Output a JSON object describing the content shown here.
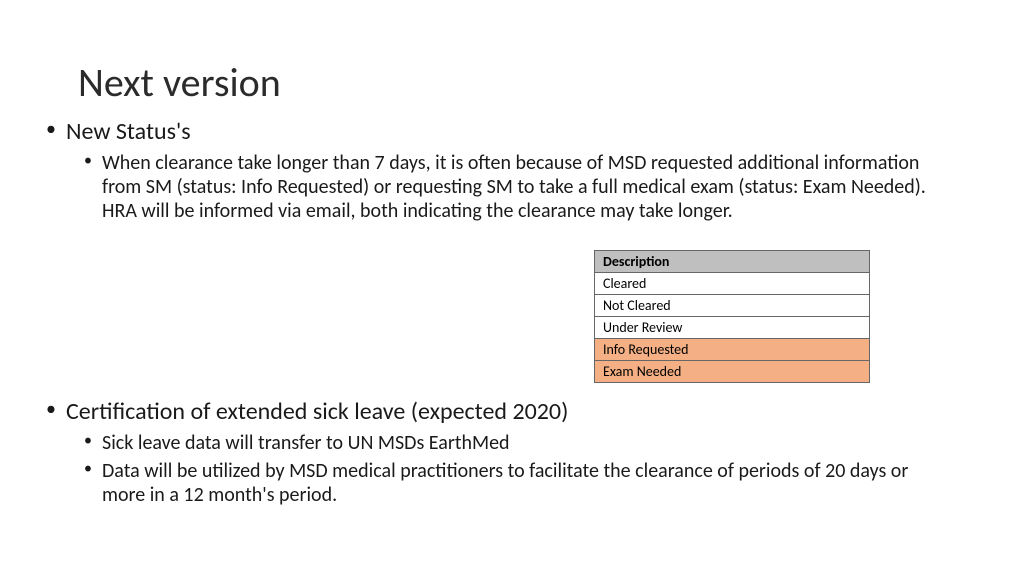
{
  "title": "Next version",
  "section1": {
    "heading": "New Status's",
    "detail": "When clearance take longer than 7 days, it is often because of MSD requested additional information from SM (status: Info Requested) or requesting SM to take a full medical exam (status: Exam Needed). HRA will be informed via email, both indicating the clearance may take longer."
  },
  "table": {
    "header": "Description",
    "rows": [
      {
        "text": "Cleared",
        "highlight": false
      },
      {
        "text": "Not Cleared",
        "highlight": false
      },
      {
        "text": "Under Review",
        "highlight": false
      },
      {
        "text": "Info Requested",
        "highlight": true
      },
      {
        "text": "Exam Needed",
        "highlight": true
      }
    ]
  },
  "section2": {
    "heading": "Certification of extended sick leave (expected 2020)",
    "detail1": "Sick leave data will transfer to UN MSDs EarthMed",
    "detail2": "Data will be utilized by MSD medical practitioners to facilitate the clearance of periods of 20 days or more in a 12 month's period."
  },
  "chart_data": {
    "type": "table",
    "columns": [
      "Description"
    ],
    "rows": [
      [
        "Cleared"
      ],
      [
        "Not Cleared"
      ],
      [
        "Under Review"
      ],
      [
        "Info Requested"
      ],
      [
        "Exam Needed"
      ]
    ],
    "highlighted_rows": [
      3,
      4
    ],
    "title": ""
  }
}
